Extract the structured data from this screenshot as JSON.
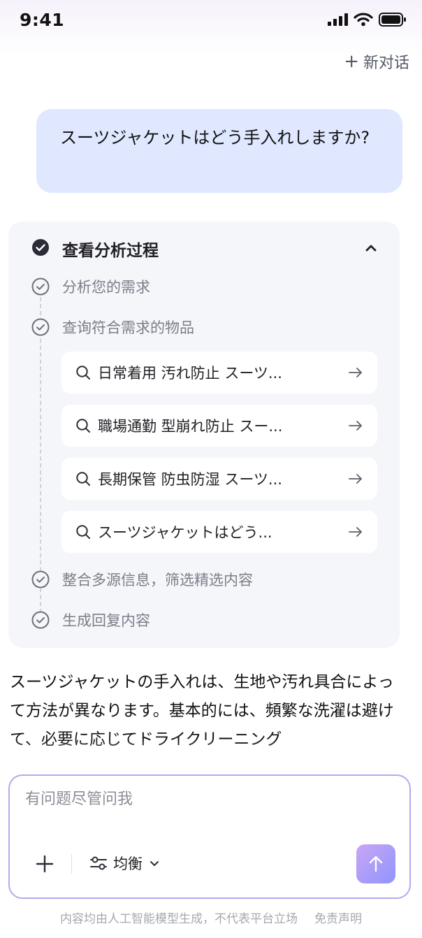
{
  "status_bar": {
    "time": "9:41"
  },
  "header": {
    "new_chat_label": "新对话"
  },
  "user_message": "スーツジャケットはどう手入れしますか?",
  "analysis": {
    "title": "查看分析过程",
    "steps": [
      "分析您的需求",
      "查询符合需求的物品",
      "整合多源信息，筛选精选内容",
      "生成回复内容"
    ],
    "queries": [
      "日常着用 汚れ防止 スーツ...",
      "職場通勤 型崩れ防止 スー...",
      "長期保管 防虫防湿 スーツ...",
      "スーツジャケットはどう..."
    ]
  },
  "answer_text": "スーツジャケットの手入れは、生地や汚れ具合によって方法が異なります。基本的には、頻繁な洗濯は避けて、必要に応じてドライクリーニング",
  "composer": {
    "placeholder": "有问题尽管问我",
    "mode_label": "均衡"
  },
  "footer": {
    "disclaimer": "内容均由人工智能模型生成，不代表平台立场",
    "disclaimer_link": "免责声明"
  },
  "colors": {
    "user_bubble": "#dfe8ff",
    "card_background": "#f5f6fa",
    "composer_border": "#b7a8f0",
    "send_gradient_start": "#c9a6f6",
    "send_gradient_end": "#8f95fb"
  }
}
